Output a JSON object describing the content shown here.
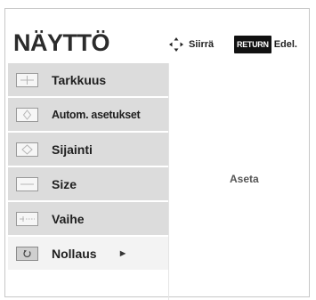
{
  "title": "NÄYTTÖ",
  "hints": {
    "move_label": "Siirrä",
    "return_key": "RETURN",
    "back_label": "Edel."
  },
  "menu": {
    "items": [
      {
        "label": "Tarkkuus",
        "icon": "resolution-icon"
      },
      {
        "label": "Autom. asetukset",
        "icon": "auto-config-icon"
      },
      {
        "label": "Sijainti",
        "icon": "position-icon"
      },
      {
        "label": "Size",
        "icon": "size-icon"
      },
      {
        "label": "Vaihe",
        "icon": "phase-icon"
      },
      {
        "label": "Nollaus",
        "icon": "reset-icon"
      }
    ],
    "submenu_arrow": "►"
  },
  "right_panel": {
    "label": "Aseta"
  },
  "colors": {
    "item_bg": "#dcdcdc",
    "last_item_bg": "#f3f3f3",
    "return_key_bg": "#111111"
  }
}
